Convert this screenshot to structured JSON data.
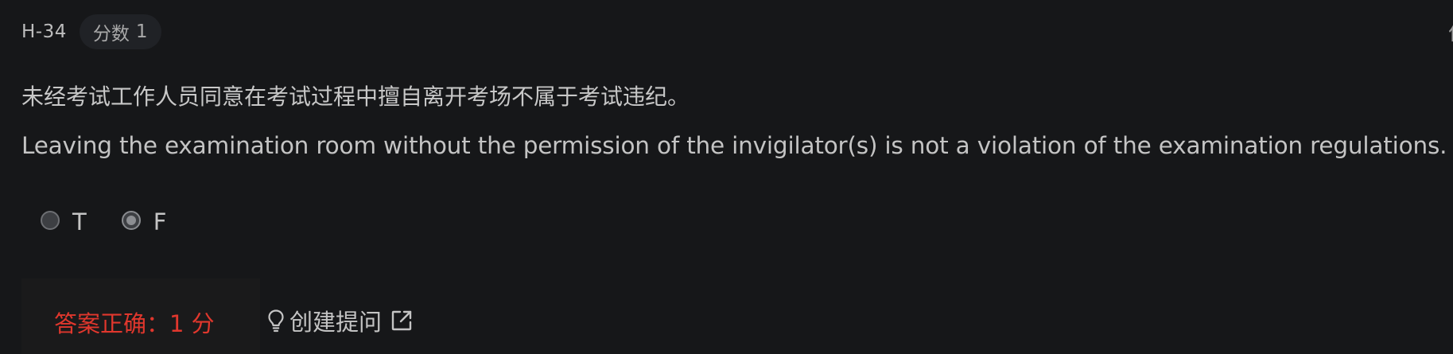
{
  "header": {
    "question_id": "H-34",
    "score_label": "分数",
    "score_value": "1",
    "corner_glyph": "作"
  },
  "question": {
    "text_cn": "未经考试工作人员同意在考试过程中擅自离开考场不属于考试违纪。",
    "text_en": "Leaving the examination room without the permission of the invigilator(s) is not a violation of the examination regulations."
  },
  "options": [
    {
      "label": "T",
      "selected": false
    },
    {
      "label": "F",
      "selected": true
    }
  ],
  "result": {
    "text": "答案正确：1 分",
    "color": "#e0372d"
  },
  "ask": {
    "label": "创建提问",
    "icon": "lightbulb-icon",
    "link_icon": "external-link-icon"
  }
}
